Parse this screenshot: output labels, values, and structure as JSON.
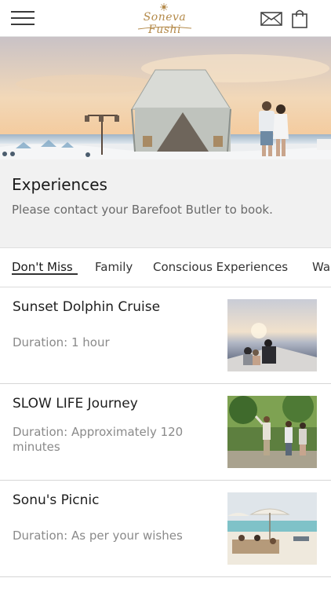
{
  "header": {
    "brand": "Soneva Fushi",
    "menu_icon": "hamburger-menu-icon",
    "mail_icon": "envelope-icon",
    "bag_icon": "shopping-bag-icon",
    "accent_color": "#b48a4a"
  },
  "hero": {
    "image": "beach-tent-sunset-couple-photo"
  },
  "intro": {
    "title": "Experiences",
    "subtitle": "Please contact your Barefoot Butler to book."
  },
  "tabs": [
    {
      "label": "Don't Miss",
      "active": true
    },
    {
      "label": "Family",
      "active": false
    },
    {
      "label": "Conscious Experiences",
      "active": false
    },
    {
      "label": "Wa",
      "active": false
    }
  ],
  "items": [
    {
      "title": "Sunset Dolphin Cruise",
      "duration": "Duration: 1 hour",
      "image": "sunset-boat-photo"
    },
    {
      "title": "SLOW LIFE Journey",
      "duration": "Duration: Approximately 120 minutes",
      "image": "garden-walk-photo"
    },
    {
      "title": "Sonu's Picnic",
      "duration": "Duration: As per your wishes",
      "image": "beach-picnic-photo"
    }
  ]
}
